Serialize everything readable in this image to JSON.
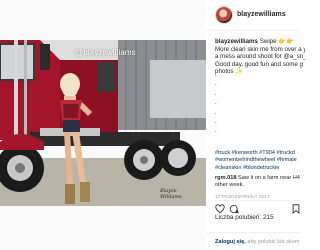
{
  "post": {
    "watermark": "@blayzewilliams",
    "signature_lines": [
      "Blayze",
      "Williams"
    ]
  },
  "header": {
    "username": "blayzewilliams"
  },
  "caption": {
    "username": "blayzewilliams",
    "text_line1": "Swipe",
    "text_line2": "More clean skin me from over a y",
    "text_line3": "a mess around shoot for @a_sn_",
    "text_line4": "Good day, good fun and some g",
    "text_line5": "photos",
    "dots": [
      ".",
      ".",
      ".",
      ".",
      ".",
      ".",
      "."
    ]
  },
  "hashtags": {
    "line1": "#truck #kenworth #T904 #truckd",
    "line2": "#womenbehindthewheel #female",
    "line3": "#cleanskin #blondetruckie"
  },
  "comment": {
    "username": "rgm.018",
    "text_line1": "Saw it on a farm near H4",
    "text_line2": "other week."
  },
  "date": "17 PAŹDZIERNIKA 2017",
  "likes": {
    "text": "Liczba polubień: 215"
  },
  "login": {
    "link": "Zaloguj się,",
    "rest": " aby polubić lub skom"
  },
  "colors": {
    "truck_red": "#a4152a",
    "link_blue": "#003569",
    "sky": "#e6e6e6"
  },
  "icons": {
    "like": "heart-icon",
    "comment": "comment-icon",
    "save": "bookmark-icon"
  }
}
